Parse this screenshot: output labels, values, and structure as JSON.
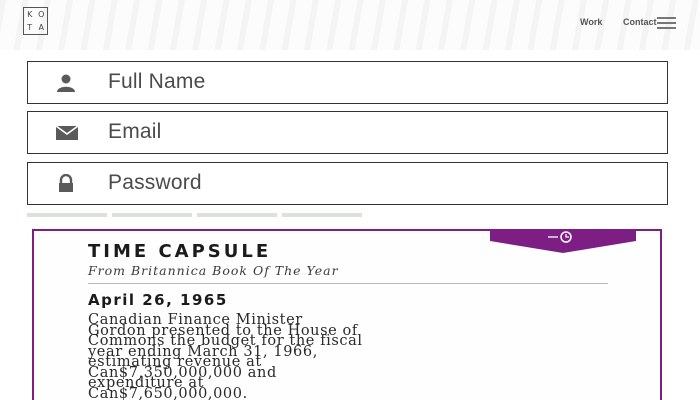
{
  "header": {
    "logo_letters": [
      "K",
      "O",
      "T",
      "A"
    ],
    "nav": {
      "work": "Work",
      "contact": "Contact"
    },
    "menu_icon": "hamburger-icon"
  },
  "form": {
    "full_name": {
      "placeholder": "Full Name",
      "icon": "user-icon"
    },
    "email": {
      "placeholder": "Email",
      "icon": "envelope-icon"
    },
    "password": {
      "placeholder": "Password",
      "icon": "lock-icon"
    },
    "strength_segments": 4
  },
  "time_capsule": {
    "title": "TIME CAPSULE",
    "subtitle": "From Britannica Book Of The Year",
    "date": "April 26, 1965",
    "body": "Canadian Finance Minister\nGordon presented to the House of\nCommons the budget for the fiscal\nyear ending March 31, 1966,\nestimating revenue at\nCan$7,350,000,000 and\nexpenditure at\nCan$7,650,000,000.",
    "badge_icon": "history-clock-icon",
    "accent_color": "#7d1e85"
  }
}
